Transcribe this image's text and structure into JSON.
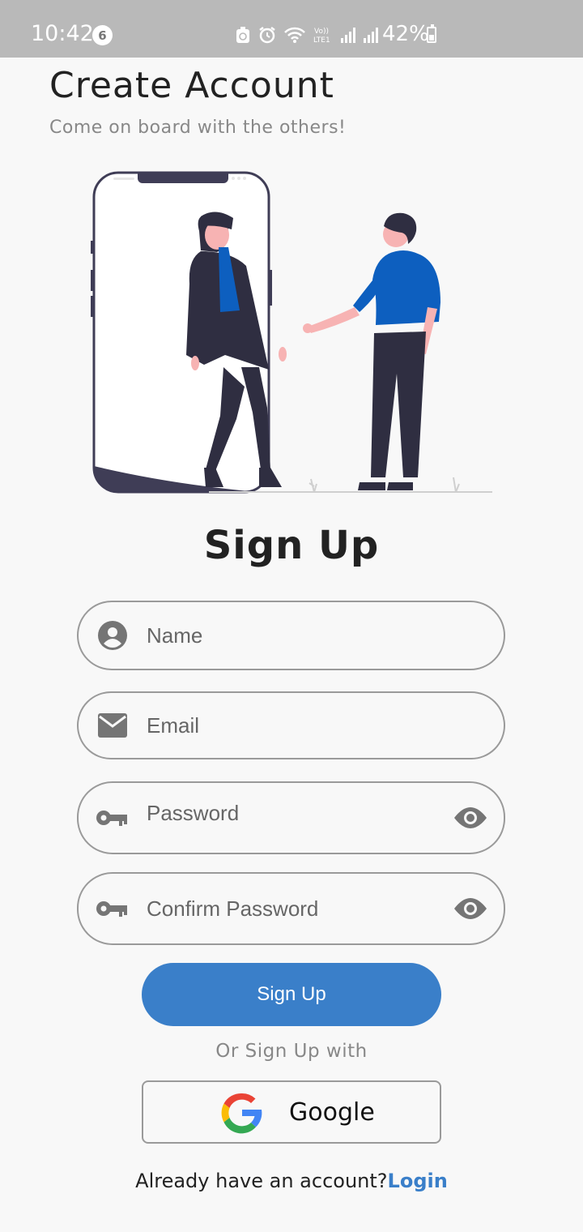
{
  "status_bar": {
    "time": "10:42",
    "notification_count": "6",
    "battery": "42%"
  },
  "header": {
    "title": "Create Account",
    "subtitle": "Come on board with the others!"
  },
  "form": {
    "heading": "Sign Up",
    "name_placeholder": "Name",
    "email_placeholder": "Email",
    "password_placeholder": "Password",
    "confirm_placeholder": "Confirm Password",
    "submit_label": "Sign Up"
  },
  "alt_signup": {
    "divider_text": "Or Sign Up with",
    "google_label": "Google"
  },
  "footer": {
    "prompt": "Already have an account?",
    "login_link": "Login"
  },
  "colors": {
    "accent": "#3a7fc9",
    "illustration_blue": "#0d5fbf",
    "dark_navy": "#2f2e41",
    "skin": "#f7b3b3"
  }
}
